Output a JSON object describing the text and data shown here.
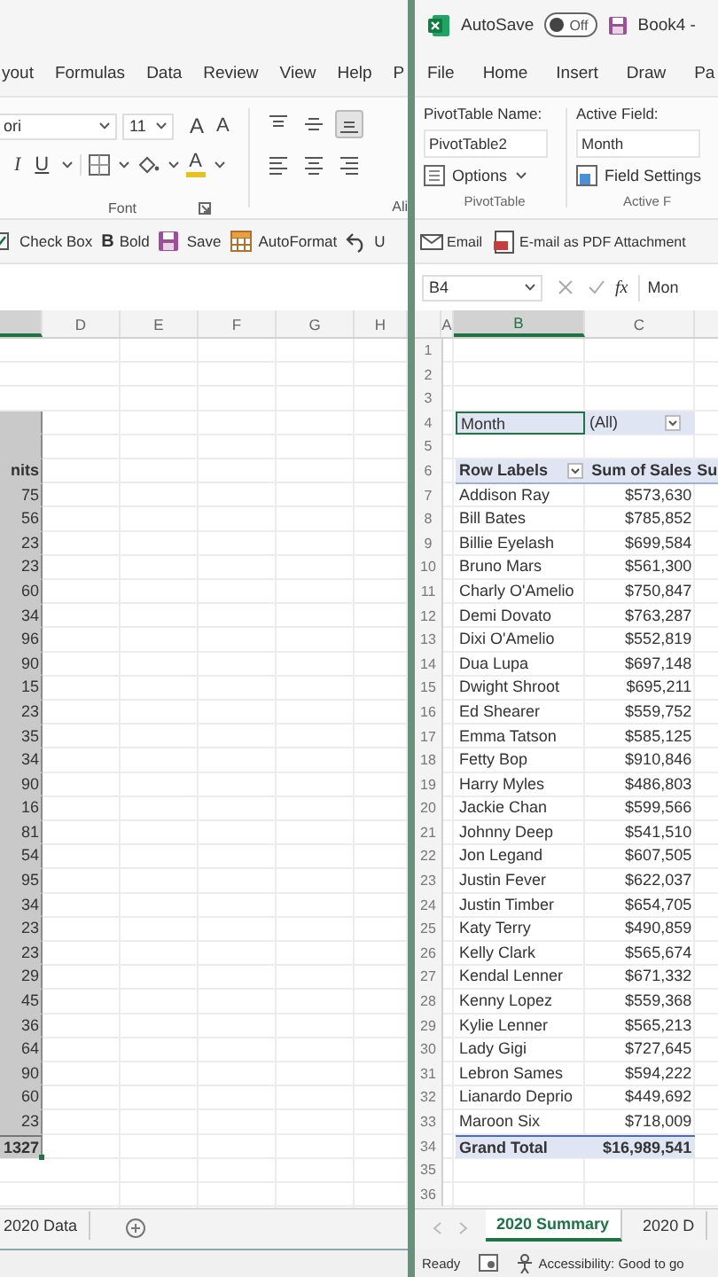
{
  "left_window": {
    "ribbon_tabs": [
      {
        "label": "yout",
        "selected": false
      },
      {
        "label": "Formulas",
        "selected": false
      },
      {
        "label": "Data",
        "selected": false
      },
      {
        "label": "Review",
        "selected": false
      },
      {
        "label": "View",
        "selected": false
      },
      {
        "label": "Help",
        "selected": false
      },
      {
        "label": "P",
        "selected": false
      }
    ],
    "font_name": "ori",
    "font_size": "11",
    "grow_label": "A",
    "shrink_label": "A",
    "style_buttons": [
      {
        "kind": "italic",
        "label": "I"
      },
      {
        "kind": "underline",
        "label": "U"
      }
    ],
    "font_color_label": "A",
    "align_buttons": [
      {
        "kind": "top",
        "selected": false
      },
      {
        "kind": "middle",
        "selected": false
      },
      {
        "kind": "bottom",
        "selected": true
      },
      {
        "kind": "left",
        "selected": false
      },
      {
        "kind": "center",
        "selected": false
      },
      {
        "kind": "right",
        "selected": false
      }
    ],
    "group_labels": [
      "Font",
      "Ali"
    ],
    "quick_access": [
      {
        "kind": "checkbox",
        "label": "Check Box"
      },
      {
        "kind": "bold",
        "glyph": "B",
        "label": "Bold"
      },
      {
        "kind": "save",
        "label": "Save"
      },
      {
        "kind": "autoformat",
        "label": "AutoFormat"
      },
      {
        "kind": "undo",
        "label": "U"
      }
    ],
    "columns": [
      {
        "selected": true
      },
      {
        "label": "D",
        "selected": false
      },
      {
        "label": "E",
        "selected": false
      },
      {
        "label": "F",
        "selected": false
      },
      {
        "label": "G",
        "selected": false
      },
      {
        "label": "H",
        "selected": false
      }
    ],
    "rows": [
      {
        "c_selected": false
      },
      {
        "c_selected": false
      },
      {
        "c_selected": false
      },
      {
        "c_selected": true
      },
      {
        "c_selected": true
      },
      {
        "kind": "header",
        "c": "nits",
        "c_selected": true
      },
      {
        "kind": "value",
        "c": "75",
        "c_selected": true
      },
      {
        "kind": "value",
        "c": "56",
        "c_selected": true
      },
      {
        "kind": "value",
        "c": "23",
        "c_selected": true
      },
      {
        "kind": "value",
        "c": "23",
        "c_selected": true
      },
      {
        "kind": "value",
        "c": "60",
        "c_selected": true
      },
      {
        "kind": "value",
        "c": "34",
        "c_selected": true
      },
      {
        "kind": "value",
        "c": "96",
        "c_selected": true
      },
      {
        "kind": "value",
        "c": "90",
        "c_selected": true
      },
      {
        "kind": "value",
        "c": "15",
        "c_selected": true
      },
      {
        "kind": "value",
        "c": "23",
        "c_selected": true
      },
      {
        "kind": "value",
        "c": "35",
        "c_selected": true
      },
      {
        "kind": "value",
        "c": "34",
        "c_selected": true
      },
      {
        "kind": "value",
        "c": "90",
        "c_selected": true
      },
      {
        "kind": "value",
        "c": "16",
        "c_selected": true
      },
      {
        "kind": "value",
        "c": "81",
        "c_selected": true
      },
      {
        "kind": "value",
        "c": "54",
        "c_selected": true
      },
      {
        "kind": "value",
        "c": "95",
        "c_selected": true
      },
      {
        "kind": "value",
        "c": "34",
        "c_selected": true
      },
      {
        "kind": "value",
        "c": "23",
        "c_selected": true
      },
      {
        "kind": "value",
        "c": "23",
        "c_selected": true
      },
      {
        "kind": "value",
        "c": "29",
        "c_selected": true
      },
      {
        "kind": "value",
        "c": "45",
        "c_selected": true
      },
      {
        "kind": "value",
        "c": "36",
        "c_selected": true
      },
      {
        "kind": "value",
        "c": "64",
        "c_selected": true
      },
      {
        "kind": "value",
        "c": "90",
        "c_selected": true
      },
      {
        "kind": "value",
        "c": "60",
        "c_selected": true
      },
      {
        "kind": "value",
        "c": "23",
        "c_selected": true
      },
      {
        "kind": "total",
        "c": "1327",
        "c_selected": true
      },
      {
        "c_selected": false
      },
      {
        "c_selected": false
      }
    ],
    "sheet_tabs": [
      {
        "label": "2020 Data",
        "selected": false
      }
    ]
  },
  "right_window": {
    "autosave_label": "AutoSave",
    "autosave_toggle": {
      "label": "Off",
      "on": false
    },
    "title": "Book4 -",
    "ribbon_tabs": [
      {
        "label": "File",
        "selected": false
      },
      {
        "label": "Home",
        "selected": false
      },
      {
        "label": "Insert",
        "selected": false
      },
      {
        "label": "Draw",
        "selected": false
      },
      {
        "label": "Pa",
        "selected": false
      }
    ],
    "pivot_name_label": "PivotTable Name:",
    "pivot_name": "PivotTable2",
    "options_label": "Options",
    "pivot_group": "PivotTable",
    "active_field_label": "Active Field:",
    "active_field": "Month",
    "field_settings_label": "Field Settings",
    "active_group": "Active F",
    "quick_access": [
      {
        "kind": "email",
        "label": "Email"
      },
      {
        "kind": "pdf",
        "label": "E-mail as PDF Attachment"
      }
    ],
    "name_box": "B4",
    "fx_label": "fx",
    "formula": "Mon",
    "columns": [
      {
        "label": "A",
        "selected": false
      },
      {
        "label": "B",
        "selected": true
      },
      {
        "label": "C",
        "selected": false
      }
    ],
    "rows": [
      {
        "number": "1"
      },
      {
        "number": "2"
      },
      {
        "number": "3"
      },
      {
        "number": "4",
        "kind": "filter",
        "b": "Month",
        "c": "(All)",
        "b_selected": true
      },
      {
        "number": "5"
      },
      {
        "number": "6",
        "kind": "header",
        "b": "Row Labels",
        "c": "Sum of Sales",
        "d": "Su"
      },
      {
        "number": "7",
        "kind": "item",
        "b": "Addison Ray",
        "c": "$573,630"
      },
      {
        "number": "8",
        "kind": "item",
        "b": "Bill Bates",
        "c": "$785,852"
      },
      {
        "number": "9",
        "kind": "item",
        "b": "Billie Eyelash",
        "c": "$699,584"
      },
      {
        "number": "10",
        "kind": "item",
        "b": "Bruno Mars",
        "c": "$561,300"
      },
      {
        "number": "11",
        "kind": "item",
        "b": "Charly O'Amelio",
        "c": "$750,847"
      },
      {
        "number": "12",
        "kind": "item",
        "b": "Demi Dovato",
        "c": "$763,287"
      },
      {
        "number": "13",
        "kind": "item",
        "b": "Dixi O'Amelio",
        "c": "$552,819"
      },
      {
        "number": "14",
        "kind": "item",
        "b": "Dua Lupa",
        "c": "$697,148"
      },
      {
        "number": "15",
        "kind": "item",
        "b": "Dwight Shroot",
        "c": "$695,211"
      },
      {
        "number": "16",
        "kind": "item",
        "b": "Ed Shearer",
        "c": "$559,752"
      },
      {
        "number": "17",
        "kind": "item",
        "b": "Emma Tatson",
        "c": "$585,125"
      },
      {
        "number": "18",
        "kind": "item",
        "b": "Fetty Bop",
        "c": "$910,846"
      },
      {
        "number": "19",
        "kind": "item",
        "b": "Harry Myles",
        "c": "$486,803"
      },
      {
        "number": "20",
        "kind": "item",
        "b": "Jackie Chan",
        "c": "$599,566"
      },
      {
        "number": "21",
        "kind": "item",
        "b": "Johnny Deep",
        "c": "$541,510"
      },
      {
        "number": "22",
        "kind": "item",
        "b": "Jon Legand",
        "c": "$607,505"
      },
      {
        "number": "23",
        "kind": "item",
        "b": "Justin Fever",
        "c": "$622,037"
      },
      {
        "number": "24",
        "kind": "item",
        "b": "Justin Timber",
        "c": "$654,705"
      },
      {
        "number": "25",
        "kind": "item",
        "b": "Katy Terry",
        "c": "$490,859"
      },
      {
        "number": "26",
        "kind": "item",
        "b": "Kelly Clark",
        "c": "$565,674"
      },
      {
        "number": "27",
        "kind": "item",
        "b": "Kendal Lenner",
        "c": "$671,332"
      },
      {
        "number": "28",
        "kind": "item",
        "b": "Kenny Lopez",
        "c": "$559,368"
      },
      {
        "number": "29",
        "kind": "item",
        "b": "Kylie Lenner",
        "c": "$565,213"
      },
      {
        "number": "30",
        "kind": "item",
        "b": "Lady Gigi",
        "c": "$727,645"
      },
      {
        "number": "31",
        "kind": "item",
        "b": "Lebron Sames",
        "c": "$594,222"
      },
      {
        "number": "32",
        "kind": "item",
        "b": "Lianardo Deprio",
        "c": "$449,692"
      },
      {
        "number": "33",
        "kind": "item",
        "b": "Maroon Six",
        "c": "$718,009"
      },
      {
        "number": "34",
        "kind": "total",
        "b": "Grand Total",
        "c": "$16,989,541"
      },
      {
        "number": "35"
      },
      {
        "number": "36"
      }
    ],
    "sheet_tabs": [
      {
        "label": "2020 Summary",
        "selected": true
      },
      {
        "label": "2020 D",
        "selected": false
      }
    ],
    "status": "Ready",
    "accessibility": "Accessibility: Good to go"
  }
}
